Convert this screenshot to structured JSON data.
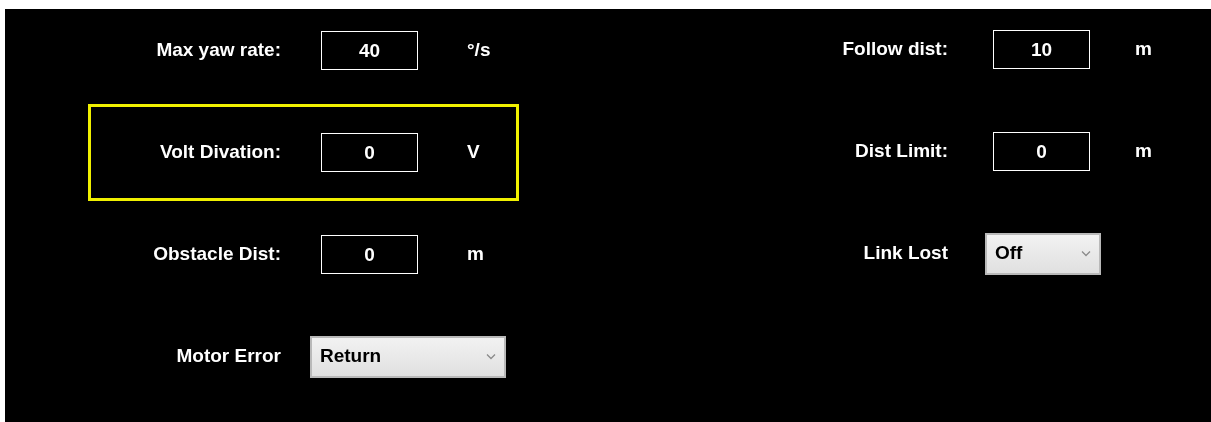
{
  "left_settings": [
    {
      "kind": "field",
      "label": "Max yaw rate:",
      "value": "40",
      "unit": "°/s",
      "highlighted": false
    },
    {
      "kind": "field",
      "label": "Volt Divation:",
      "value": "0",
      "unit": "V",
      "highlighted": true
    },
    {
      "kind": "field",
      "label": "Obstacle Dist:",
      "value": "0",
      "unit": "m",
      "highlighted": false
    },
    {
      "kind": "dropdown",
      "label": "Motor Error",
      "value": "Return",
      "highlighted": false
    }
  ],
  "right_settings": [
    {
      "kind": "field",
      "label": "Follow dist:",
      "value": "10",
      "unit": "m",
      "highlighted": false
    },
    {
      "kind": "field",
      "label": "Dist Limit:",
      "value": "0",
      "unit": "m",
      "highlighted": false
    },
    {
      "kind": "dropdown",
      "label": "Link Lost",
      "value": "Off",
      "highlighted": false
    }
  ]
}
